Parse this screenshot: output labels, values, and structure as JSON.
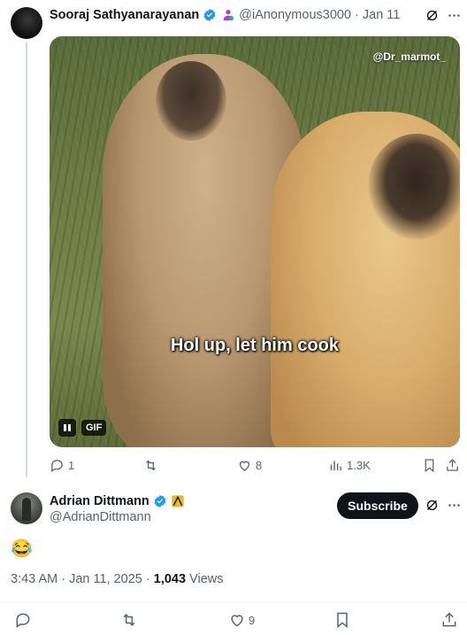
{
  "tweet1": {
    "display_name": "Sooraj Sathyanarayanan",
    "handle": "@iAnonymous3000",
    "separator": "·",
    "date": "Jan 11",
    "media": {
      "watermark": "@Dr_marmot_",
      "caption": "Hol up, let him cook",
      "badge": "GIF"
    },
    "actions": {
      "replies": "1",
      "likes": "8",
      "views": "1.3K"
    }
  },
  "tweet2": {
    "display_name": "Adrian Dittmann",
    "handle": "@AdrianDittmann",
    "subscribe_label": "Subscribe",
    "body": "😂",
    "time": "3:43 AM",
    "dot": " · ",
    "date": "Jan 11, 2025",
    "views_count": "1,043",
    "views_label": "Views",
    "actions": {
      "likes": "9"
    }
  },
  "colors": {
    "verified": "#1d9bf0",
    "text": "#0f1419",
    "muted": "#536471"
  },
  "icons": [
    "grok-icon",
    "more-icon",
    "reply-icon",
    "retweet-icon",
    "like-icon",
    "views-icon",
    "bookmark-icon",
    "share-icon",
    "pause-icon",
    "verified-badge-icon"
  ]
}
